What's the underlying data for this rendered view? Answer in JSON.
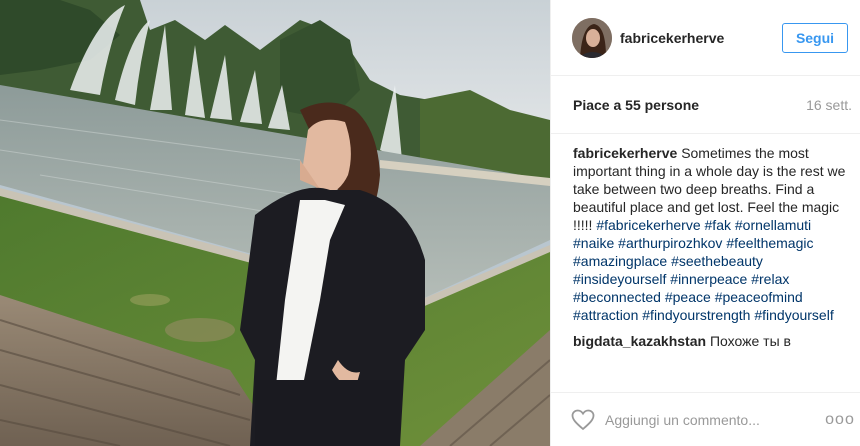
{
  "post": {
    "username": "fabricekerherve",
    "follow_label": "Segui",
    "likes_text": "Piace a 55 persone",
    "age_text": "16 sett.",
    "caption_user": "fabricekerherve",
    "caption_text": "Sometimes the most important thing in a whole day is the rest we take between two deep breaths. Find a beautiful place and get lost. Feel the magic !!!!!",
    "hashtags": [
      "#fabricekerherve",
      "#fak",
      "#ornellamuti",
      "#naike",
      "#arthurpirozhkov",
      "#feelthemagic",
      "#amazingplace",
      "#seethebeauty",
      "#insideyourself",
      "#innerpeace",
      "#relax",
      "#beconnected",
      "#peace",
      "#peaceofmind",
      "#attraction",
      "#findyourstrength",
      "#findyourself"
    ],
    "comment_user": "bigdata_kazakhstan",
    "comment_text": "Похоже ты в",
    "comment_placeholder": "Aggiungi un commento...",
    "more_label": "ooo"
  },
  "icons": {
    "like": "heart-icon",
    "more": "more-options-icon",
    "avatar": "profile-avatar"
  },
  "colors": {
    "accent": "#3897f0",
    "hashtag": "#003569",
    "muted": "#999999"
  }
}
